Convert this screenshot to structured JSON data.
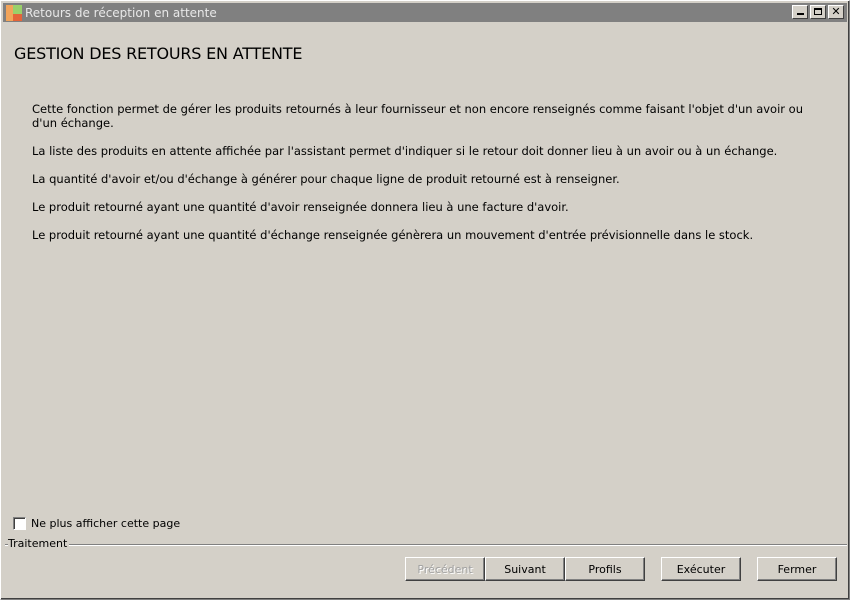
{
  "window": {
    "title": "Retours de réception en attente"
  },
  "page": {
    "title": "GESTION DES RETOURS EN ATTENTE",
    "paragraphs": [
      "Cette fonction permet de gérer les produits retournés à leur fournisseur et non encore renseignés comme faisant l'objet d'un avoir ou d'un échange.",
      "La liste des produits en attente affichée par l'assistant permet d'indiquer si le retour doit donner lieu à un avoir ou à un échange.",
      "La quantité d'avoir et/ou d'échange à générer pour chaque ligne de produit retourné est à renseigner.",
      "Le produit retourné ayant une quantité d'avoir renseignée donnera lieu à une facture d'avoir.",
      "Le produit retourné ayant une quantité d'échange renseignée génèrera un mouvement d'entrée prévisionnelle dans le stock."
    ]
  },
  "options": {
    "hide_page_label": "Ne plus afficher cette page",
    "hide_page_checked": false
  },
  "footer": {
    "group_label": "Traitement",
    "buttons": {
      "previous": {
        "label": "Précédent",
        "enabled": false
      },
      "next": {
        "label": "Suivant",
        "enabled": true
      },
      "profiles": {
        "label": "Profils",
        "enabled": true
      },
      "execute": {
        "label": "Exécuter",
        "enabled": true
      },
      "close": {
        "label": "Fermer",
        "enabled": true
      }
    }
  }
}
